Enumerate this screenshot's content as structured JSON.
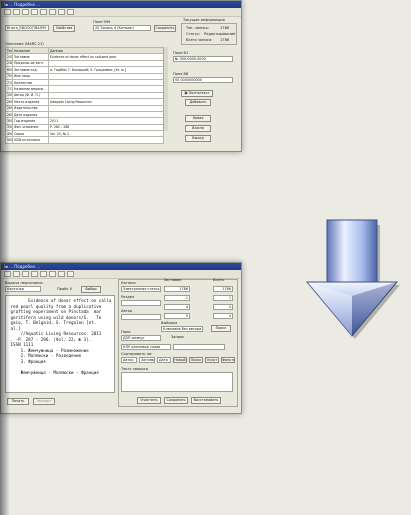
{
  "top_window": {
    "title": "I▪ ... Подробно ...",
    "toolbar_count": 8,
    "record_label": "Поле 999",
    "record_id_left": "Книга_БВ/2007/ВАЛ99",
    "record_value": "20 Запись 4 (Каталог)",
    "button_properties": "Свойства",
    "button_save": "Сохранить",
    "info_header": "Текущая информация",
    "info_rows": [
      {
        "label": "Тек. запись:",
        "value": "1786"
      },
      {
        "label": "Статус:",
        "value": "Редактирование"
      },
      {
        "label": "Всего записи:",
        "value": "1786"
      }
    ],
    "grid_caption": "Описание (MARC 21)",
    "grid_headers": [
      "Тег",
      "Название",
      "Данные"
    ],
    "grid_rows": [
      [
        "245",
        "Заглавие",
        "Evidence of donor effect on callused pear"
      ],
      [
        "246",
        "Продолж-ие загл.",
        ""
      ],
      [
        "650",
        "Заглавие отд.",
        "и. Горбёв; Т. Беляцкий; S. Грицкевич; [et. al.]"
      ],
      [
        "700",
        "Имя лица",
        ""
      ],
      [
        "710",
        "Коллектив",
        ""
      ],
      [
        "711",
        "Название меропр.",
        ""
      ],
      [
        "100",
        "Автор (Ф. И. О.)",
        ""
      ],
      [
        "260",
        "Место издания",
        "Jzbapolis Living Resources"
      ],
      [
        "260",
        "Издательство",
        ""
      ],
      [
        "260",
        "Дата издания",
        ""
      ],
      [
        "300",
        "Год издания",
        "2011"
      ],
      [
        "340",
        "Физ. описание",
        "Р. 282 - 288"
      ],
      [
        "490",
        "Серия",
        "Vol. 25, № 2"
      ],
      [
        "500",
        "ISSN источника",
        ""
      ]
    ],
    "field_b1_label": "Поле В1",
    "field_b1_value": "№ 000-0000-0000",
    "field_b8_label": "Поле В8",
    "field_b8_value": "00 0000000000",
    "btn_search": "Полнотекст",
    "btn_send": "Добавить",
    "btn_new": "Новая",
    "btn_delete": "Важно",
    "btn_close": "Выход"
  },
  "bottom_window": {
    "title": "I▪ ... Подробно ...",
    "left_header": "Выдача персонализ.",
    "left_select": "Карточка",
    "left_next": "Прайс V",
    "left_exec": "Выбор",
    "preview_text": "        Evidence of donor effect on calla\n red pearl quality from a duplicative\n grafting experiment on Pinctada  mar\n garitifera using wild donors/S.   Te\n gaio, T. Belgaid, S. Tregalon [et.\n al.]\n     //Aquatic Living Resources. 2011\n . -P. 287 - 296. (Vol. 22, № 3).\n ISSN 1111\n     1. Жемчужница - Размножение\n     2. Моллюски - Разведение\n     3. Франция\n\n     Жемчужница - Моллюски - Франция",
    "left_btn_print": "Печать",
    "left_btn_export": "Экспорт",
    "catalog_label": "Каталог",
    "catalog_value": "Электронная статья",
    "section_label": "Раздел",
    "author_label": "Автор",
    "title_label": "Заглавие",
    "key_label": "Ключевые",
    "count_header": "Всего",
    "counts": [
      "1786",
      "1",
      "4",
      "0"
    ],
    "index_values": [
      "1786",
      "1",
      "4",
      "0"
    ],
    "selection_label": "Выборка",
    "selection_value": "Ключевое без автора",
    "btn_search": "Поиск",
    "field_label": "Поле",
    "query_label": "Запрос",
    "query_value": "Ключевые слова",
    "key_value": "ДЗП жемчуг",
    "key_value2": "КЛУ ключевые слова",
    "sort_label": "Сортировать по:",
    "sort_options": [
      "Автор",
      "Заглавие",
      "Ключ."
    ],
    "radio_sort_1": "Автор",
    "radio_sort_2": "Заглавие",
    "radio_sort_3": "Дата",
    "btn_new": "Новый",
    "btn_find": "Поиск",
    "btn_clear": "Очист",
    "btn_filter": "Фильтр",
    "notes_label": "Текст запроса",
    "btn_clean": "Очистить",
    "btn_save": "Сохранить",
    "btn_restore": "Восстановить"
  },
  "arrow": {
    "direction": "down",
    "color": "#8aa6e6"
  }
}
